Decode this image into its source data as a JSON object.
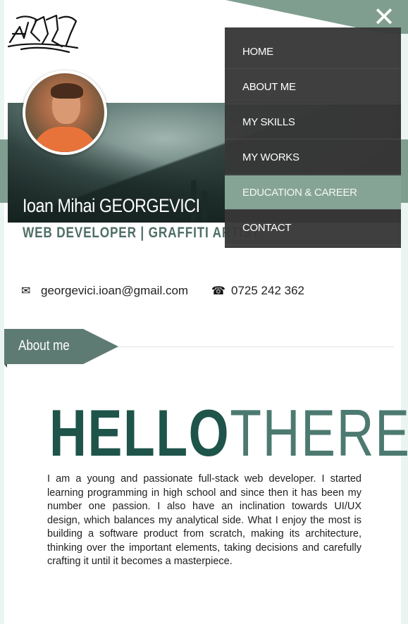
{
  "nav": {
    "close_icon": "close-icon",
    "items": [
      {
        "label": "HOME",
        "active": false
      },
      {
        "label": "ABOUT ME",
        "active": false
      },
      {
        "label": "MY SKILLS",
        "active": false
      },
      {
        "label": "MY WORKS",
        "active": false
      },
      {
        "label": "EDUCATION & CAREER",
        "active": true
      },
      {
        "label": "CONTACT",
        "active": false
      }
    ]
  },
  "profile": {
    "name": "Ioan Mihai GEORGEVICI",
    "subtitle": "WEB DEVELOPER  | GRAFFITI ARTIST"
  },
  "contact": {
    "email_icon": "envelope-icon",
    "email": "georgevici.ioan@gmail.com",
    "phone_icon": "phone-icon",
    "phone": "0725 242 362"
  },
  "about": {
    "tag": "About me",
    "hello_bold": "HELLO",
    "hello_light": "THERE!",
    "text": "I am a young and passionate full-stack web developer. I started learning programming in high school and since then it has been my number one passion. I also have an inclination towards UI/UX design, which balances my analytical side. What I enjoy the most is building a software product from scratch, making its architecture, thinking over the important elements, taking decisions and carefully crafting it until it becomes a masterpiece."
  },
  "colors": {
    "accent": "#7f9e90",
    "dark_green": "#1e544a",
    "menu_bg": "#373737",
    "menu_active": "#86a496"
  }
}
